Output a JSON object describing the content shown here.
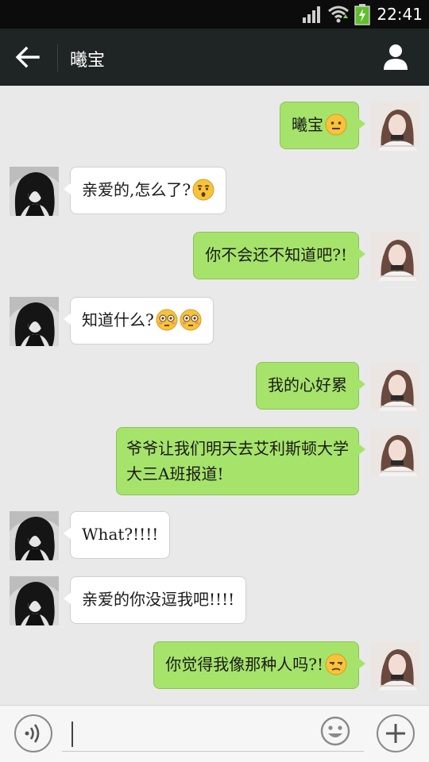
{
  "status_bar": {
    "time": "22:41",
    "icons": [
      "signal-icon",
      "wifi-icon",
      "battery-charging-icon"
    ]
  },
  "header": {
    "back_icon": "arrow-left-icon",
    "title": "曦宝",
    "profile_icon": "person-icon"
  },
  "colors": {
    "header_bg": "#1f2524",
    "chat_bg": "#e9e9e9",
    "outgoing_bubble": "#a6e36b",
    "incoming_bubble": "#ffffff"
  },
  "messages": [
    {
      "direction": "out",
      "text": "曦宝",
      "emoji": [
        "neutral-face"
      ]
    },
    {
      "direction": "in",
      "text": "亲爱的,怎么了?",
      "emoji": [
        "hushed-face"
      ]
    },
    {
      "direction": "out",
      "text": "你不会还不知道吧?!",
      "emoji": []
    },
    {
      "direction": "in",
      "text": "知道什么?",
      "emoji": [
        "flushed-face",
        "flushed-face"
      ]
    },
    {
      "direction": "out",
      "text": "我的心好累",
      "emoji": []
    },
    {
      "direction": "out",
      "line1": "爷爷让我们明天去艾利斯顿大学",
      "line2": "大三A班报道!",
      "emoji": []
    },
    {
      "direction": "in",
      "text": "What?!!!!",
      "emoji": []
    },
    {
      "direction": "in",
      "text": "亲爱的你没逗我吧!!!!",
      "emoji": []
    },
    {
      "direction": "out",
      "text": "你觉得我像那种人吗?!",
      "emoji": [
        "unamused-face"
      ]
    }
  ],
  "input_bar": {
    "voice_icon": "voice-icon",
    "emoji_icon": "smiley-icon",
    "plus_icon": "plus-icon",
    "value": ""
  }
}
